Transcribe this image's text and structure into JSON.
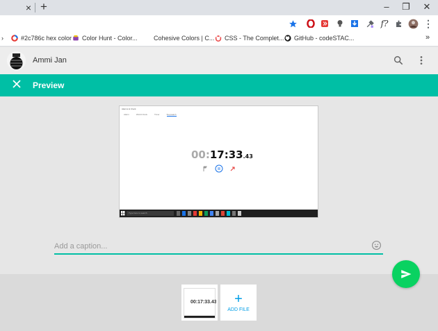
{
  "browser": {
    "tab_close": "×",
    "new_tab": "+",
    "window_controls": [
      "–",
      "❐",
      "✕"
    ],
    "extensions": [
      {
        "name": "star-icon",
        "color": "#1a73e8"
      },
      {
        "name": "opera-icon",
        "color": "#cc0f16"
      },
      {
        "name": "record-icon",
        "color": "#e53935"
      },
      {
        "name": "bulb-icon",
        "color": "#555555"
      },
      {
        "name": "download-icon",
        "color": "#1a73e8"
      },
      {
        "name": "eyedropper-icon",
        "color": "#5f6368"
      },
      {
        "name": "fx-icon",
        "color": "#333333"
      },
      {
        "name": "puzzle-icon",
        "color": "#5f6368"
      },
      {
        "name": "profile-icon",
        "color": "#8d6e63"
      },
      {
        "name": "kebab-icon",
        "color": "#5f6368"
      }
    ],
    "bookmarks": [
      {
        "label": "#2c786c hex color",
        "icon": "ring-icon",
        "color": "#e53935"
      },
      {
        "label": "Color Hunt - Color...",
        "icon": "colorhunt-icon",
        "color": "#8e44ad"
      },
      {
        "label": "Cohesive Colors | C...",
        "icon": "",
        "color": ""
      },
      {
        "label": "CSS - The Complet...",
        "icon": "udemy-icon",
        "color": "#ec5252"
      },
      {
        "label": "GitHub - codeSTAC...",
        "icon": "github-icon",
        "color": "#111111"
      }
    ],
    "bookmarks_overflow": "»"
  },
  "chat_header": {
    "contact_name": "Ammi Jan"
  },
  "preview": {
    "title": "Preview",
    "image": {
      "window_title": "Alarms & Clock",
      "tabs": [
        "Alarm",
        "World Clock",
        "Timer",
        "Stopwatch"
      ],
      "timer": {
        "dim": "00:",
        "main": "17:33",
        "ms": ".43"
      },
      "taskbar_search": "Type here to search"
    }
  },
  "caption": {
    "placeholder": "Add a caption..."
  },
  "tray": {
    "thumb_timer": "00:17:33.43",
    "add_file_plus": "+",
    "add_file_label": "ADD FILE"
  },
  "colors": {
    "accent": "#00bfa5",
    "send": "#09d261",
    "add_file": "#009ee6"
  }
}
